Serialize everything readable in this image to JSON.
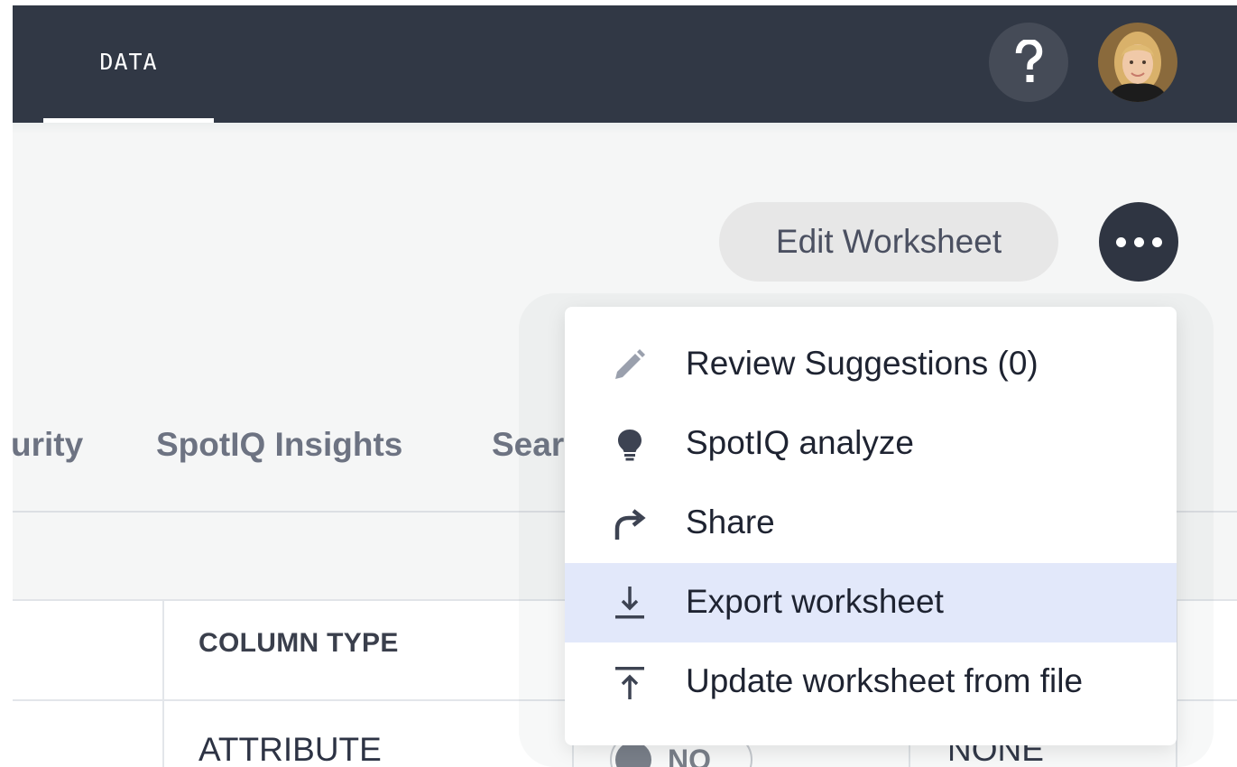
{
  "topbar": {
    "nav_tab": "DATA",
    "help_label": "?"
  },
  "header": {
    "edit_label": "Edit Worksheet"
  },
  "tabs": {
    "security": "urity",
    "spotiq_insights": "SpotIQ Insights",
    "search": "Sear"
  },
  "table": {
    "column_type_header": "COLUMN TYPE",
    "row1_column_type": "ATTRIBUTE",
    "row1_toggle_label": "NO",
    "row1_last_cell": "NONE"
  },
  "menu": {
    "items": [
      {
        "label": "Review Suggestions (0)",
        "icon": "pencil-icon"
      },
      {
        "label": "SpotIQ analyze",
        "icon": "lightbulb-icon"
      },
      {
        "label": "Share",
        "icon": "share-arrow-icon"
      },
      {
        "label": "Export worksheet",
        "icon": "download-icon"
      },
      {
        "label": "Update worksheet from file",
        "icon": "upload-icon"
      }
    ],
    "active_index": 3
  },
  "colors": {
    "topbar": "#313845",
    "page_background": "#f5f6f6",
    "menu_highlight": "#e2e8fa",
    "more_button": "#2f3542"
  }
}
